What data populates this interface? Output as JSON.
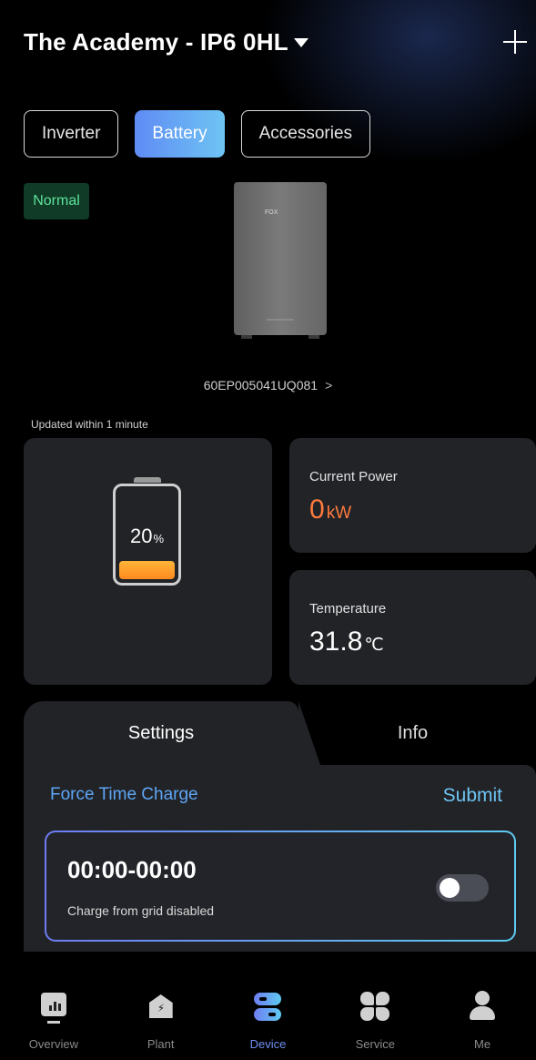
{
  "header": {
    "title": "The Academy - IP6 0HL"
  },
  "tabs": [
    {
      "label": "Inverter",
      "active": false
    },
    {
      "label": "Battery",
      "active": true
    },
    {
      "label": "Accessories",
      "active": false
    }
  ],
  "status": {
    "label": "Normal",
    "color": "#5ee39a"
  },
  "device": {
    "logo": "FOX",
    "serial": "60EP005041UQ081",
    "updated": "Updated  within 1 minute"
  },
  "battery": {
    "soc_value": "20",
    "soc_unit": "%",
    "soc_fraction": 0.2
  },
  "current_power": {
    "label": "Current Power",
    "value": "0",
    "unit": "kW"
  },
  "temperature": {
    "label": "Temperature",
    "value": "31.8",
    "unit": "℃"
  },
  "panel": {
    "tabs": {
      "settings": "Settings",
      "info": "Info"
    },
    "heading": "Force Time Charge",
    "submit": "Submit",
    "schedule": {
      "time": "00:00-00:00",
      "description": "Charge from grid disabled",
      "enabled": false
    }
  },
  "nav": [
    {
      "label": "Overview",
      "icon": "chart-icon"
    },
    {
      "label": "Plant",
      "icon": "house-icon"
    },
    {
      "label": "Device",
      "icon": "device-icon",
      "active": true
    },
    {
      "label": "Service",
      "icon": "grid-icon"
    },
    {
      "label": "Me",
      "icon": "person-icon"
    }
  ],
  "colors": {
    "accent": "#5ea6f5",
    "power": "#ff7a3d",
    "background": "#000000",
    "card": "#212327"
  }
}
